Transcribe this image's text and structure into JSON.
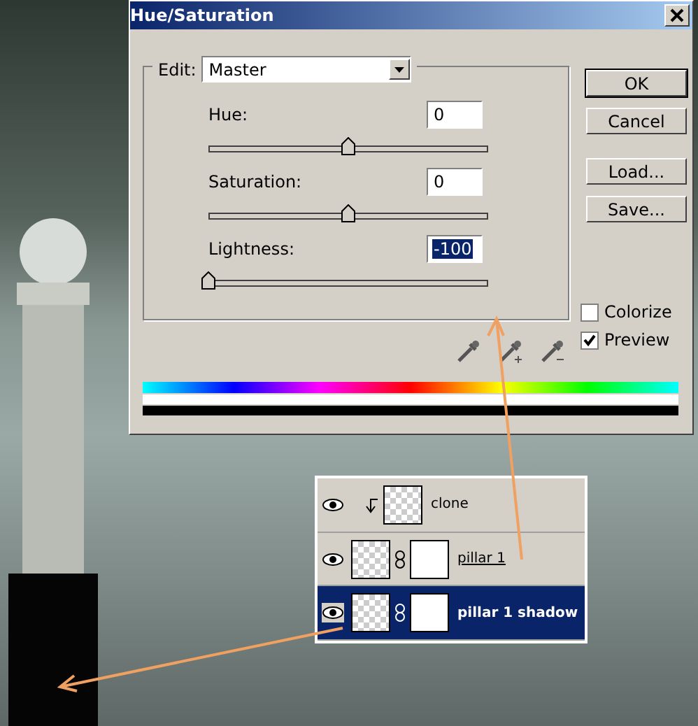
{
  "dialog": {
    "title": "Hue/Saturation",
    "edit_label": "Edit:",
    "edit_value": "Master",
    "sliders": [
      {
        "label": "Hue:",
        "value": "0",
        "level": 0.5,
        "selected": false
      },
      {
        "label": "Saturation:",
        "value": "0",
        "level": 0.5,
        "selected": false
      },
      {
        "label": "Lightness:",
        "value": "-100",
        "level": 0,
        "selected": true
      }
    ],
    "buttons": [
      {
        "label": "OK",
        "default": true
      },
      {
        "label": "Cancel",
        "default": false
      },
      {
        "label": "Load...",
        "default": false
      },
      {
        "label": "Save...",
        "default": false
      }
    ],
    "checkboxes": [
      {
        "label": "Colorize",
        "checked": false
      },
      {
        "label": "Preview",
        "checked": true
      }
    ]
  },
  "layers": [
    {
      "name": "clone",
      "kind": "clipped",
      "selected": false,
      "underlined": false
    },
    {
      "name": "pillar 1",
      "kind": "masked",
      "selected": false,
      "underlined": true
    },
    {
      "name": "pillar 1 shadow",
      "kind": "masked",
      "selected": true,
      "underlined": false
    }
  ]
}
